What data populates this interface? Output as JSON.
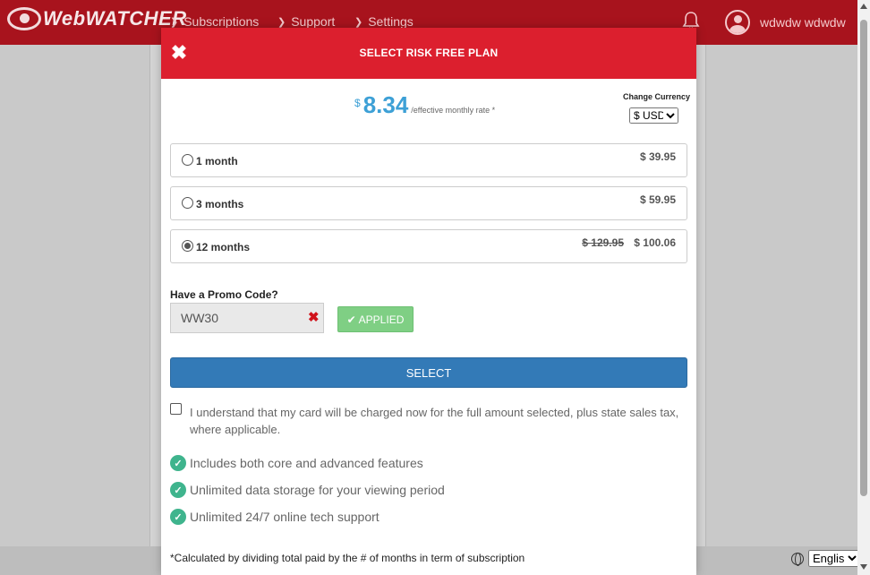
{
  "header": {
    "logo_text": "WebWATCHER",
    "nav": [
      "Subscriptions",
      "Support",
      "Settings"
    ],
    "username": "wdwdw wdwdw"
  },
  "modal": {
    "title": "SELECT RISK FREE PLAN",
    "price": {
      "currency_symbol": "$",
      "amount": "8.34",
      "note": "/effective monthly rate *"
    },
    "currency": {
      "label": "Change Currency",
      "selected": "$ USD"
    },
    "plans": [
      {
        "label": "1 month",
        "price": "$ 39.95",
        "old_price": "",
        "selected": false
      },
      {
        "label": "3 months",
        "price": "$ 59.95",
        "old_price": "",
        "selected": false
      },
      {
        "label": "12 months",
        "price": "$ 100.06",
        "old_price": "$ 129.95",
        "selected": true
      }
    ],
    "promo": {
      "label": "Have a Promo Code?",
      "value": "WW30",
      "applied_label": "APPLIED"
    },
    "select_label": "SELECT",
    "agreement": "I understand that my card will be charged now for the full amount selected, plus state sales tax, where applicable.",
    "features": [
      "Includes both core and advanced features",
      "Unlimited data storage for your viewing period",
      "Unlimited 24/7 online tech support"
    ],
    "footnote": "*Calculated by dividing total paid by the # of months in term of subscription"
  },
  "footer": {
    "language": "English"
  },
  "colors": {
    "brand_red": "#a8131d",
    "modal_header": "#dc1f2e",
    "price_blue": "#3da0d6",
    "select_blue": "#337ab7",
    "applied_green": "#7fcf84",
    "check_green": "#3fb48d"
  }
}
